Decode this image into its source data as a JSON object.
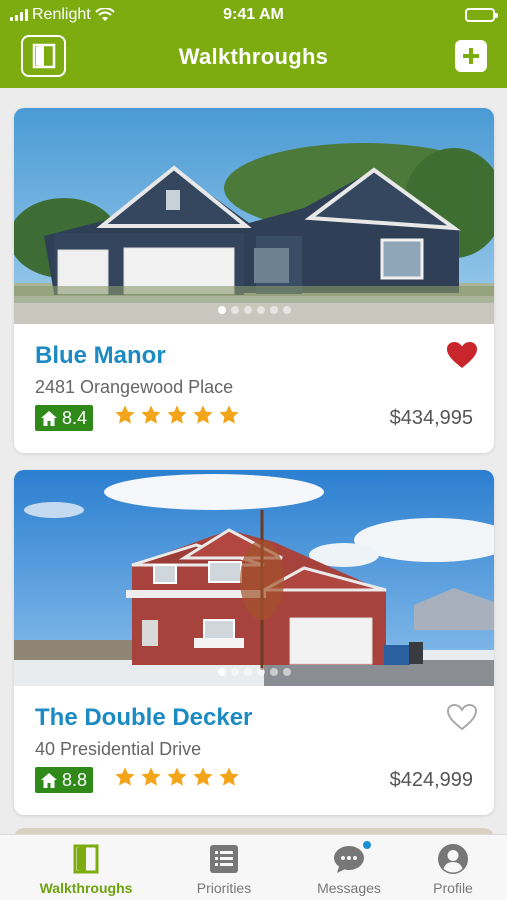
{
  "status": {
    "carrier": "Renlight",
    "time": "9:41 AM"
  },
  "header": {
    "title": "Walkthroughs"
  },
  "listings": [
    {
      "name": "Blue Manor",
      "address": "2481 Orangewood Place",
      "score": "8.4",
      "rating": 5,
      "price": "$434,995",
      "favorited": true
    },
    {
      "name": "The Double Decker",
      "address": "40 Presidential Drive",
      "score": "8.8",
      "rating": 5,
      "price": "$424,999",
      "favorited": false
    }
  ],
  "tabs": [
    {
      "label": "Walkthroughs",
      "icon": "door-icon",
      "active": true
    },
    {
      "label": "Priorities",
      "icon": "list-icon",
      "active": false
    },
    {
      "label": "Messages",
      "icon": "chat-icon",
      "active": false
    },
    {
      "label": "Profile",
      "icon": "profile-icon",
      "active": false
    }
  ],
  "colors": {
    "brand_green": "#7cac0f",
    "title_blue": "#1c8bc3",
    "score_green": "#2f8a19",
    "star": "#f2a51a",
    "heart_red": "#c8252c"
  }
}
